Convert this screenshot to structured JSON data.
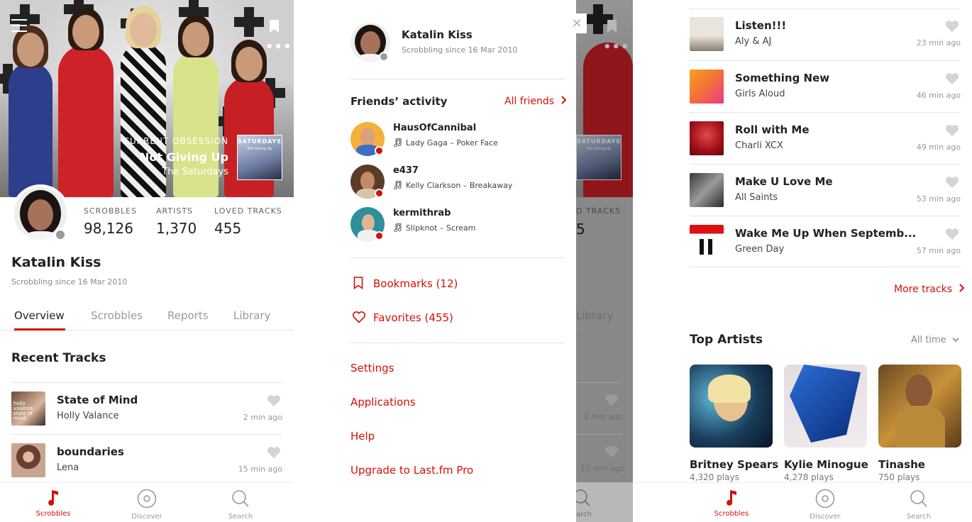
{
  "profile": {
    "name": "Katalin Kiss",
    "since": "Scrobbling since 16 Mar 2010",
    "current_obsession_label": "CURRENT OBSESSION",
    "current_obsession_track": "Not Giving Up",
    "current_obsession_artist": "The Saturdays",
    "cover_title": "SATURDAYS",
    "cover_subtitle": "Not Giving Up",
    "stats": [
      {
        "label": "SCROBBLES",
        "value": "98,126"
      },
      {
        "label": "ARTISTS",
        "value": "1,370"
      },
      {
        "label": "LOVED TRACKS",
        "value": "455"
      }
    ]
  },
  "tabs": [
    "Overview",
    "Scrobbles",
    "Reports",
    "Library"
  ],
  "recent_tracks_title": "Recent Tracks",
  "recent_tracks": [
    {
      "title": "State of Mind",
      "artist": "Holly Valance",
      "time": "2 min ago",
      "cover_text": "holly valance state of mind"
    },
    {
      "title": "boundaries",
      "artist": "Lena",
      "time": "15 min ago"
    }
  ],
  "recent_tracks_more": [
    {
      "title": "Listen!!!",
      "artist": "Aly & AJ",
      "time": "23 min ago"
    },
    {
      "title": "Something New",
      "artist": "Girls Aloud",
      "time": "46 min ago"
    },
    {
      "title": "Roll with Me",
      "artist": "Charli XCX",
      "time": "49 min ago"
    },
    {
      "title": "Make U Love Me",
      "artist": "All Saints",
      "time": "53 min ago"
    },
    {
      "title": "Wake Me Up When Septemb...",
      "artist": "Green Day",
      "time": "57 min ago"
    }
  ],
  "more_tracks_label": "More tracks",
  "top_artists": {
    "title": "Top Artists",
    "period": "All time",
    "items": [
      {
        "name": "Britney Spears",
        "plays": "4,320 plays"
      },
      {
        "name": "Kylie Minogue",
        "plays": "4,278 plays"
      },
      {
        "name": "Tinashe",
        "plays": "750 plays"
      }
    ]
  },
  "drawer": {
    "friends_title": "Friends’ activity",
    "all_friends_label": "All friends",
    "friends": [
      {
        "name": "HausOfCannibal",
        "now": "Lady Gaga – Poker Face"
      },
      {
        "name": "e437",
        "now": "Kelly Clarkson – Breakaway"
      },
      {
        "name": "kermithrab",
        "now": "Slipknot – Scream"
      }
    ],
    "bookmarks_label": "Bookmarks (12)",
    "favorites_label": "Favorites (455)",
    "menu": [
      "Settings",
      "Applications",
      "Help",
      "Upgrade to Last.fm Pro"
    ],
    "close_glyph": "×"
  },
  "dimmed_peek": {
    "stat_label_partial": "D TRACKS",
    "stat_value_partial": "5",
    "tab_partial": "Library",
    "nav_partial": "arch"
  },
  "bottom_nav": [
    {
      "label": "Scrobbles",
      "icon": "music-note-icon",
      "active": true
    },
    {
      "label": "Discover",
      "icon": "disc-icon",
      "active": false
    },
    {
      "label": "Search",
      "icon": "search-icon",
      "active": false
    }
  ],
  "colors": {
    "accent": "#d51007",
    "text": "#222222",
    "muted": "#999999"
  }
}
